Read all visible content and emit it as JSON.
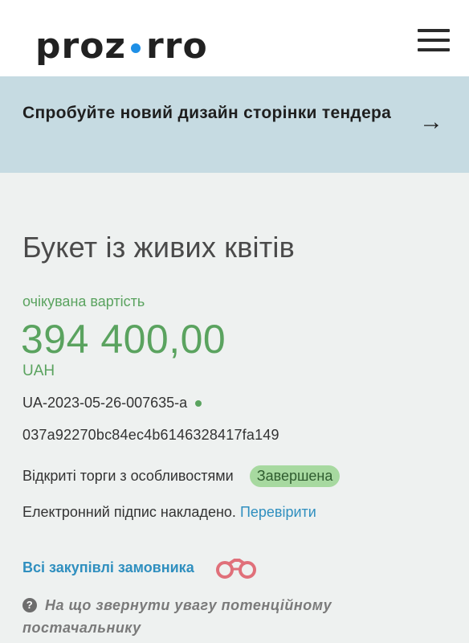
{
  "header": {
    "logo_left": "proz",
    "logo_right": "rro",
    "menu_icon": "hamburger-menu-icon"
  },
  "banner": {
    "text": "Спробуйте новий дизайн сторінки тендера",
    "arrow": "→"
  },
  "tender": {
    "title": "Букет із живих квітів",
    "expected_label": "очікувана вартість",
    "amount": "394 400,00",
    "currency": "UAH",
    "id": "UA-2023-05-26-007635-a",
    "hash": "037a92270bc84ec4b6146328417fa149",
    "procedure_type": "Відкриті торги з особливостями",
    "status": "Завершена",
    "signature_text": "Електронний підпис накладено.",
    "signature_link": "Перевірити",
    "buyer_link": "Всі закупівлі замовника",
    "hint_icon": "?",
    "hint_text": "На що звернути увагу потенційному постачальнику"
  },
  "colors": {
    "accent_blue": "#1e8fe6",
    "link_blue": "#2f8fbf",
    "money_green": "#5aa35f",
    "badge_green": "#a7d9a0",
    "banner_bg": "#c6dbe2",
    "main_bg": "#eef1f0",
    "binoculars": "#e0707a"
  }
}
